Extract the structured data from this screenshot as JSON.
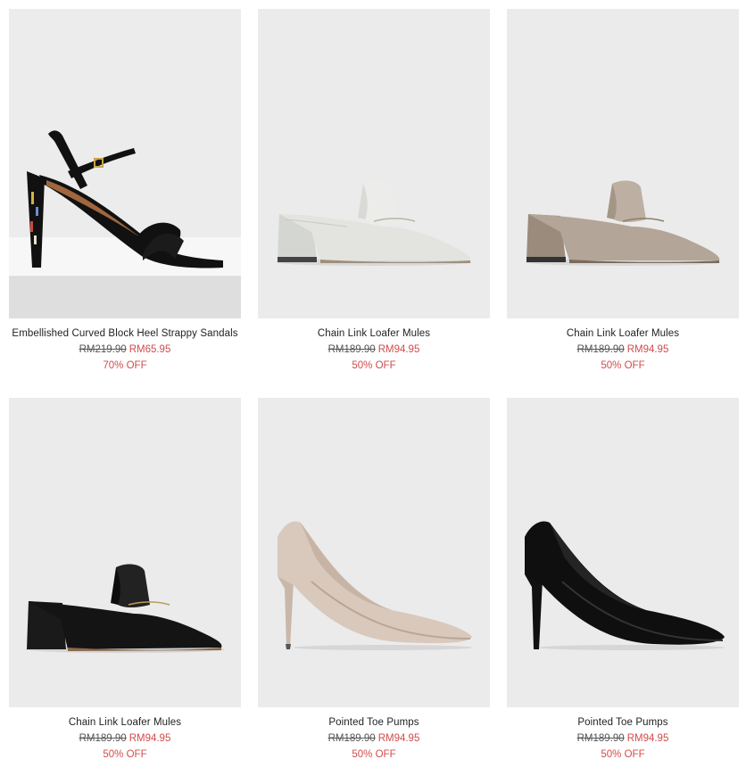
{
  "products": [
    {
      "name": "Embellished Curved Block Heel Strappy Sandals",
      "was": "RM219.90",
      "now": "RM65.95",
      "off": "70% OFF",
      "colour": "black",
      "type": "sandal"
    },
    {
      "name": "Chain Link Loafer Mules",
      "was": "RM189.90",
      "now": "RM94.95",
      "off": "50% OFF",
      "colour": "white",
      "type": "mule"
    },
    {
      "name": "Chain Link Loafer Mules",
      "was": "RM189.90",
      "now": "RM94.95",
      "off": "50% OFF",
      "colour": "taupe",
      "type": "mule"
    },
    {
      "name": "Chain Link Loafer Mules",
      "was": "RM189.90",
      "now": "RM94.95",
      "off": "50% OFF",
      "colour": "black",
      "type": "mule"
    },
    {
      "name": "Pointed Toe Pumps",
      "was": "RM189.90",
      "now": "RM94.95",
      "off": "50% OFF",
      "colour": "nude",
      "type": "pump"
    },
    {
      "name": "Pointed Toe Pumps",
      "was": "RM189.90",
      "now": "RM94.95",
      "off": "50% OFF",
      "colour": "black",
      "type": "pump"
    }
  ],
  "colors": {
    "background": "#ffffff",
    "photo_background": "#ebebeb",
    "sale_red": "#d24b4b",
    "text": "#222222"
  }
}
